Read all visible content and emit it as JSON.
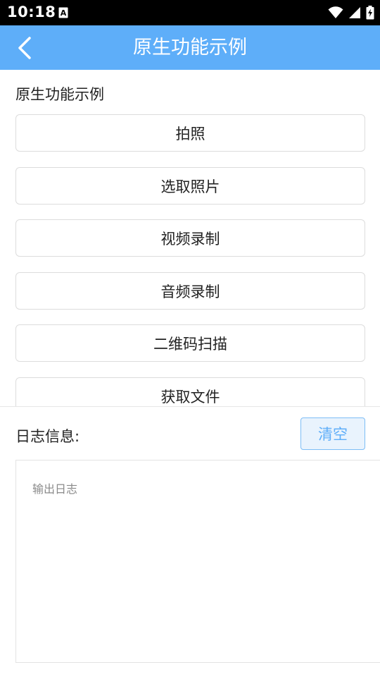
{
  "status_bar": {
    "time": "10:18",
    "icons": [
      "a-notification-icon",
      "wifi-icon",
      "signal-icon",
      "battery-charging-icon"
    ]
  },
  "header": {
    "title": "原生功能示例",
    "back_icon": "chevron-left-icon"
  },
  "section": {
    "title": "原生功能示例"
  },
  "actions": [
    {
      "label": "拍照"
    },
    {
      "label": "选取照片"
    },
    {
      "label": "视频录制"
    },
    {
      "label": "音频录制"
    },
    {
      "label": "二维码扫描"
    },
    {
      "label": "获取文件"
    }
  ],
  "log": {
    "label": "日志信息:",
    "clear_label": "清空",
    "placeholder": "输出日志"
  },
  "colors": {
    "header_bg": "#5eaef9",
    "accent": "#5eaef9"
  }
}
